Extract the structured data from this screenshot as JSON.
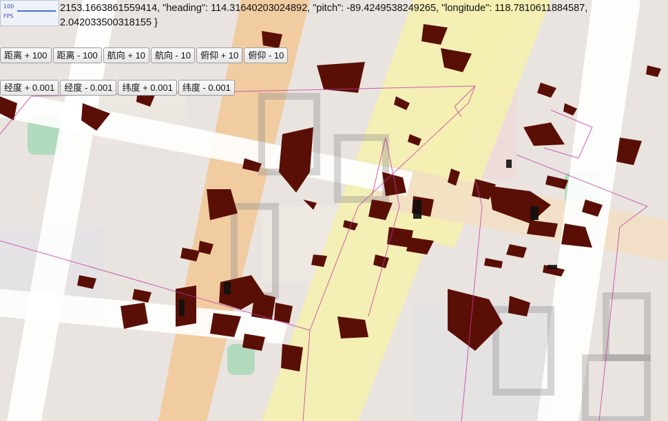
{
  "fps": {
    "value": "100",
    "unit": "FPS"
  },
  "camera_info": {
    "line1": "2153.1663861559414, \"heading\": 114.31640203024892, \"pitch\": -89.4249538249265, \"longitude\": 118.7810611884587,",
    "line2": "2.042033500318155 }"
  },
  "toolbar_row1": [
    {
      "label": "距离 + 100"
    },
    {
      "label": "距离 - 100"
    },
    {
      "label": "航向 + 10"
    },
    {
      "label": "航向 - 10"
    },
    {
      "label": "俯仰 + 10"
    },
    {
      "label": "俯仰 - 10"
    }
  ],
  "toolbar_row2": [
    {
      "label": "经度 + 0.001"
    },
    {
      "label": "经度 - 0.001"
    },
    {
      "label": "纬度 + 0.001"
    },
    {
      "label": "纬度 - 0.001"
    }
  ],
  "colors": {
    "map_background": "#e9e4df",
    "road_yellow": "#f4efb0",
    "road_orange": "#f2c99a",
    "building": "#5a0f06",
    "outline": "#c23aa6",
    "park": "#a8d8b8"
  }
}
